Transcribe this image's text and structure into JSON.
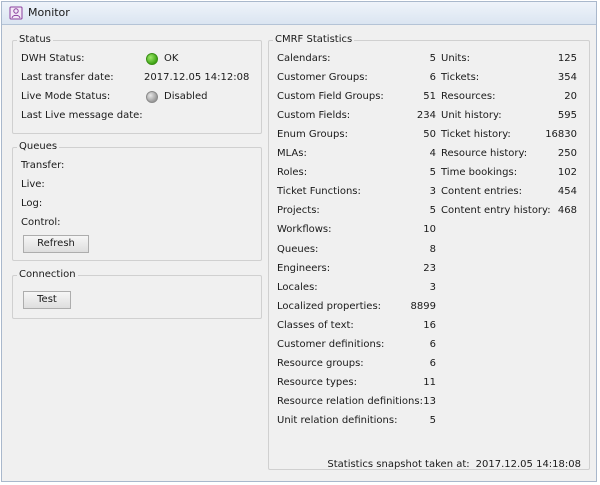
{
  "window": {
    "title": "Monitor",
    "icon": "monitor-app-icon"
  },
  "status": {
    "title": "Status",
    "rows": [
      {
        "label": "DWH Status:",
        "value": "OK",
        "indicator": "green"
      },
      {
        "label": "Last transfer date:",
        "value": "2017.12.05 14:12:08"
      },
      {
        "label": "Live Mode Status:",
        "value": "Disabled",
        "indicator": "gray"
      },
      {
        "label": "Last Live message date:",
        "value": ""
      }
    ]
  },
  "queues": {
    "title": "Queues",
    "rows": [
      {
        "label": "Transfer:"
      },
      {
        "label": "Live:"
      },
      {
        "label": "Log:"
      },
      {
        "label": "Control:"
      }
    ],
    "refresh_label": "Refresh"
  },
  "connection": {
    "title": "Connection",
    "test_label": "Test"
  },
  "cmrf": {
    "title": "CMRF Statistics",
    "left": [
      {
        "name": "Calendars:",
        "value": "5"
      },
      {
        "name": "Customer Groups:",
        "value": "6"
      },
      {
        "name": "Custom Field Groups:",
        "value": "51"
      },
      {
        "name": "Custom Fields:",
        "value": "234"
      },
      {
        "name": "Enum Groups:",
        "value": "50"
      },
      {
        "name": "MLAs:",
        "value": "4"
      },
      {
        "name": "Roles:",
        "value": "5"
      },
      {
        "name": "Ticket Functions:",
        "value": "3"
      },
      {
        "name": "Projects:",
        "value": "5"
      },
      {
        "name": "Workflows:",
        "value": "10"
      },
      {
        "name": "Queues:",
        "value": "8"
      },
      {
        "name": "Engineers:",
        "value": "23"
      },
      {
        "name": "Locales:",
        "value": "3"
      },
      {
        "name": "Localized properties:",
        "value": "8899"
      },
      {
        "name": "Classes of text:",
        "value": "16"
      },
      {
        "name": "Customer definitions:",
        "value": "6"
      },
      {
        "name": "Resource groups:",
        "value": "6"
      },
      {
        "name": "Resource types:",
        "value": "11"
      },
      {
        "name": "Resource relation definitions:",
        "value": "13"
      },
      {
        "name": "Unit relation definitions:",
        "value": "5"
      }
    ],
    "right": [
      {
        "name": "Units:",
        "value": "125"
      },
      {
        "name": "Tickets:",
        "value": "354"
      },
      {
        "name": "Resources:",
        "value": "20"
      },
      {
        "name": "Unit history:",
        "value": "595"
      },
      {
        "name": "Ticket history:",
        "value": "16830"
      },
      {
        "name": "Resource history:",
        "value": "250"
      },
      {
        "name": "Time bookings:",
        "value": "102"
      },
      {
        "name": "Content entries:",
        "value": "454"
      },
      {
        "name": "Content entry history:",
        "value": "468"
      }
    ],
    "snapshot_label": "Statistics snapshot taken at:",
    "snapshot_value": "2017.12.05 14:18:08"
  }
}
